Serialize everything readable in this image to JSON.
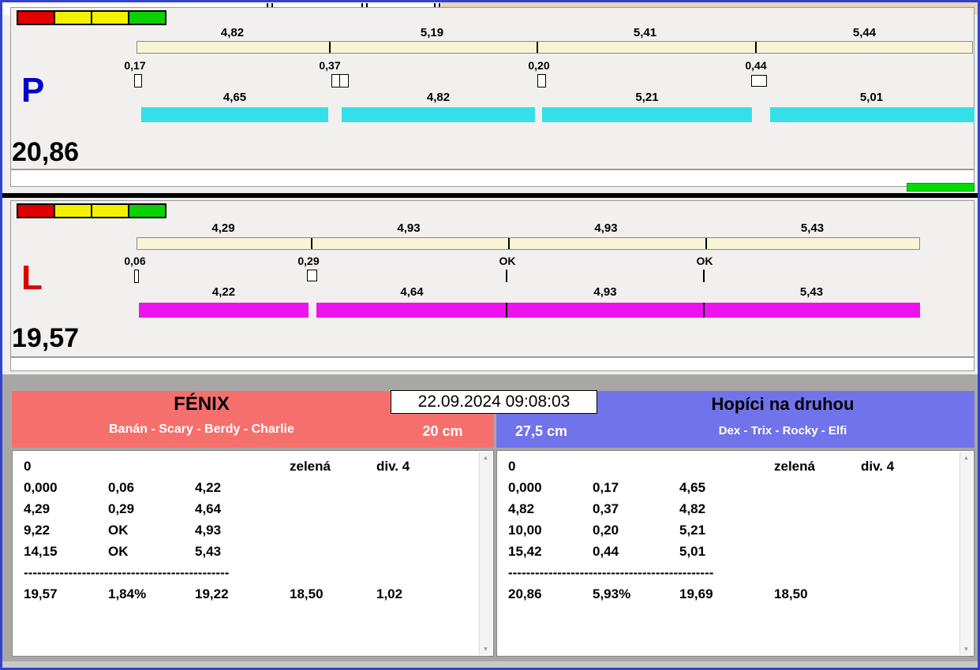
{
  "datetime": "22.09.2024 09:08:03",
  "icons": {
    "scroll_up": "▲",
    "scroll_down": "▼"
  },
  "colors": {
    "window_border": "#3143cf",
    "lane_p_bar": "#35dfe8",
    "lane_l_bar": "#ee12ee",
    "split_bar": "#f8f4d8",
    "finish_bar": "#00dd00",
    "team_left_header": "#f5706d",
    "team_right_header": "#7173ea",
    "status_lights": [
      "#e10000",
      "#f2f200",
      "#f2f200",
      "#0bd100"
    ]
  },
  "lanes": [
    {
      "label": "P",
      "label_color": "#0000cc",
      "total": "20,86",
      "splits": [
        "4,82",
        "5,19",
        "5,41",
        "5,44"
      ],
      "gaps": [
        "0,17",
        "0,37",
        "0,20",
        "0,44"
      ],
      "segments": [
        "4,65",
        "4,82",
        "5,21",
        "5,01"
      ]
    },
    {
      "label": "L",
      "label_color": "#dd0000",
      "total": "19,57",
      "splits": [
        "4,29",
        "4,93",
        "4,93",
        "5,43"
      ],
      "gaps": [
        "0,06",
        "0,29",
        "OK",
        "OK"
      ],
      "segments": [
        "4,22",
        "4,64",
        "4,93",
        "5,43"
      ]
    }
  ],
  "teams": [
    {
      "name": "FÉNIX",
      "members": "Banán - Scary - Berdy - Charlie",
      "height": "20 cm",
      "info": {
        "faults": "0",
        "card": "zelená",
        "division": "div. 4"
      },
      "rows": [
        [
          "0,000",
          "0,06",
          "4,22"
        ],
        [
          "4,29",
          "0,29",
          "4,64"
        ],
        [
          "9,22",
          "OK",
          "4,93"
        ],
        [
          "14,15",
          "OK",
          "5,43"
        ]
      ],
      "separator": "----------------------------------------------",
      "totals": [
        "19,57",
        "1,84%",
        "19,22",
        "18,50",
        "1,02"
      ]
    },
    {
      "name": "Hopíci na druhou",
      "members": "Dex - Trix - Rocky - Elfi",
      "height": "27,5 cm",
      "info": {
        "faults": "0",
        "card": "zelená",
        "division": "div. 4"
      },
      "rows": [
        [
          "0,000",
          "0,17",
          "4,65"
        ],
        [
          "4,82",
          "0,37",
          "4,82"
        ],
        [
          "10,00",
          "0,20",
          "5,21"
        ],
        [
          "15,42",
          "0,44",
          "5,01"
        ]
      ],
      "separator": "----------------------------------------------",
      "totals": [
        "20,86",
        "5,93%",
        "19,69",
        "18,50"
      ]
    }
  ]
}
